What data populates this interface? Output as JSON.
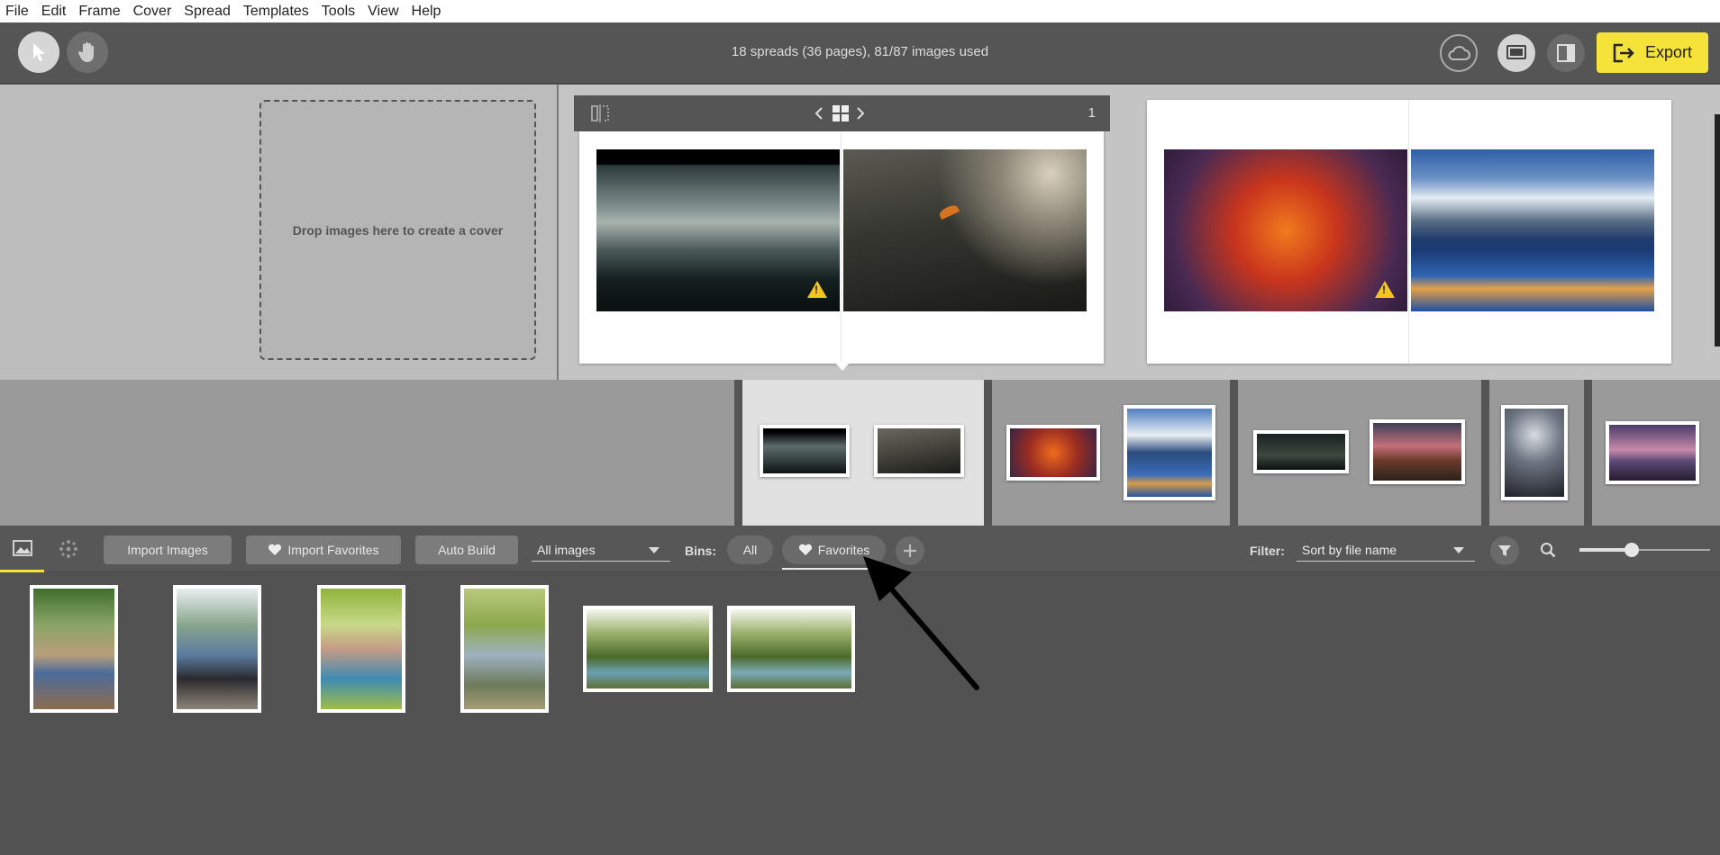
{
  "menu": [
    "File",
    "Edit",
    "Frame",
    "Cover",
    "Spread",
    "Templates",
    "Tools",
    "View",
    "Help"
  ],
  "toolbar": {
    "summary": "18 spreads (36 pages), 81/87 images used",
    "export_label": "Export"
  },
  "cover": {
    "drop_text": "Drop images here to create a cover"
  },
  "spread": {
    "page_number": "1"
  },
  "panel": {
    "import_images": "Import Images",
    "import_favorites": "Import Favorites",
    "auto_build": "Auto Build",
    "images_select": "All images",
    "bins_label": "Bins:",
    "bin_all": "All",
    "bin_favorites": "Favorites",
    "filter_label": "Filter:",
    "sort_select": "Sort by file name",
    "zoom_level": 0.4
  },
  "colors": {
    "accent": "#f6e33a",
    "warning": "#f3c51d"
  },
  "icons": [
    "pointer-icon",
    "hand-icon",
    "cloud-icon",
    "single-page-icon",
    "split-view-icon",
    "export-icon",
    "image-tab-icon",
    "effects-tab-icon",
    "heart-icon",
    "plus-icon",
    "filter-icon",
    "search-icon",
    "grid-icon",
    "chevron-left-icon",
    "chevron-right-icon",
    "page-split-icon",
    "warning-icon"
  ]
}
